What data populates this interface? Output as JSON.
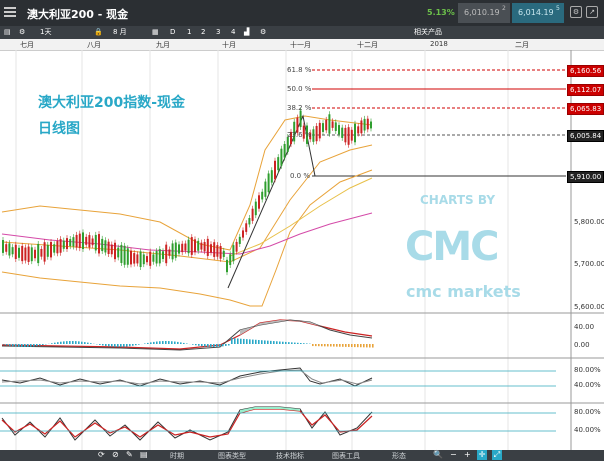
{
  "window": {
    "title": "澳大利亚200 - 现金",
    "change_pct": "5.13%",
    "sell_price": "6,010.19",
    "buy_price": "6,014.19",
    "sell_badge": "2",
    "buy_badge": "5"
  },
  "toolbar": {
    "interval_label": "1天",
    "count_label": "8 月",
    "draw_d": "D",
    "slot1": "1",
    "slot2": "2",
    "slot3": "3",
    "slot4": "4",
    "related_products": "相关产品"
  },
  "time_axis": {
    "months": [
      "七月",
      "八月",
      "九月",
      "十月",
      "十一月",
      "十二月",
      "2018",
      "二月"
    ]
  },
  "chart": {
    "title_line1": "澳大利亚200指数-现金",
    "title_line2": "日线图",
    "watermark_top": "CHARTS BY",
    "watermark_bottom": "cmc markets",
    "fib_levels": [
      "61.8 %",
      "50.0 %",
      "38.2 %",
      "23.6 %",
      "0.0 %"
    ],
    "price_tags": [
      "6,160.56",
      "6,112.07",
      "6,065.83",
      "6,005.84",
      "5,910.00"
    ],
    "y_ticks": [
      "5,800.00",
      "5,700.00",
      "5,600.00"
    ]
  },
  "indicators": {
    "macd_ticks": [
      "40.00",
      "0.00"
    ],
    "stoch1_ticks": [
      "80.00%",
      "40.00%"
    ],
    "stoch2_ticks": [
      "80.00%",
      "40.00%"
    ]
  },
  "bottom_bar": {
    "tab_timespan": "时期",
    "tab_chart_type": "图表类型",
    "tab_indicators": "技术指标",
    "tab_drawing": "图表工具",
    "tab_shapes": "形态"
  },
  "colors": {
    "accent_green": "#6cc04a",
    "accent_teal": "#29a8c7",
    "fib_red": "#d00000",
    "candle_green": "#2e9e2e",
    "candle_red": "#cc2222"
  }
}
